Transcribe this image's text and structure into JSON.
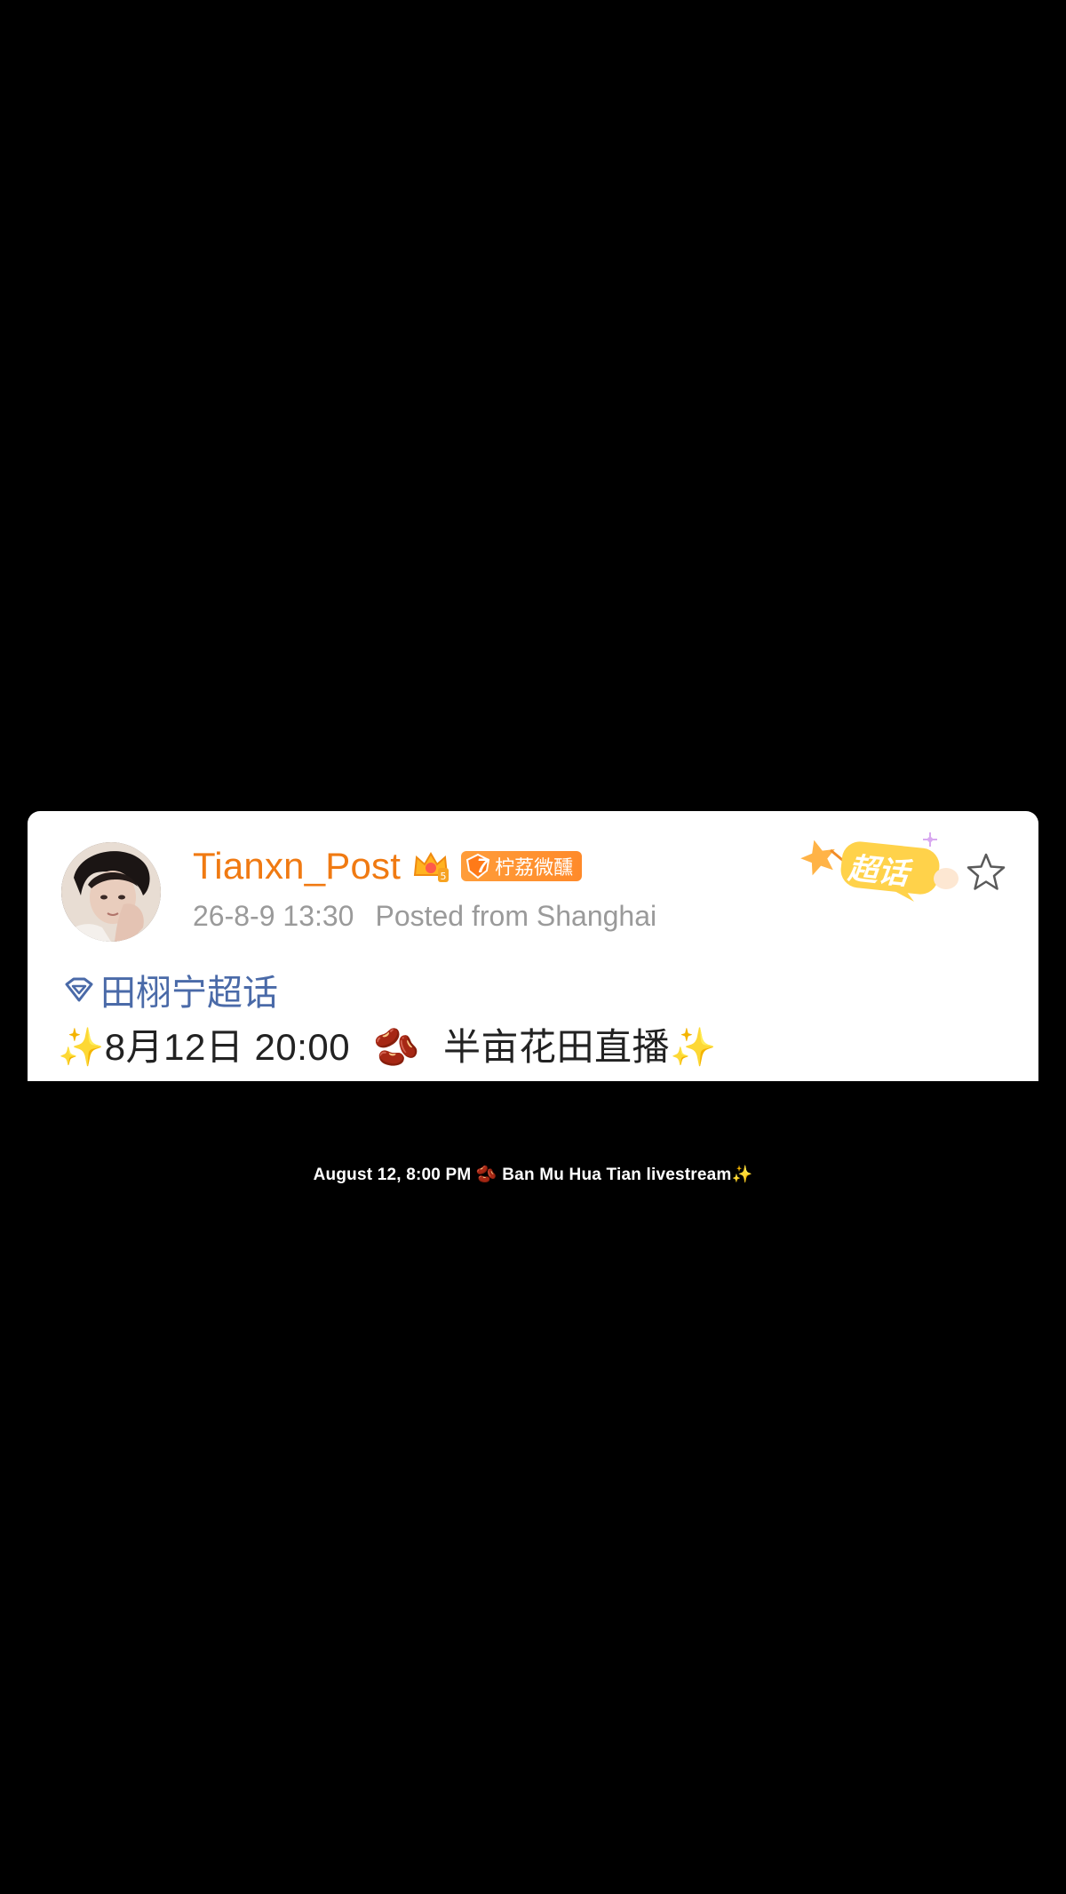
{
  "post": {
    "username": "Tianxn_Post",
    "fan_badge_level": "7",
    "fan_badge_label": "柠荔微醺",
    "timestamp": "26-8-9 13:30",
    "location": "Posted from Shanghai",
    "supertopic_sticker": "超话",
    "topic": "田栩宁超话",
    "body_date": "8月12日 20:00",
    "body_text": "半亩花田直播",
    "sparkle": "✨",
    "bean": "🫘"
  },
  "caption": {
    "text": "August 12, 8:00 PM 🫘 Ban Mu Hua Tian livestream✨"
  },
  "colors": {
    "background": "#000000",
    "card": "#ffffff",
    "username": "#f07a12",
    "meta": "#9a9a9a",
    "topic": "#4a6aa8",
    "body": "#222222",
    "badge": "#ff8a2a"
  },
  "icons": {
    "crown": "vip-crown-icon",
    "topic": "diamond-topic-icon",
    "favorite": "star-outline-icon"
  }
}
